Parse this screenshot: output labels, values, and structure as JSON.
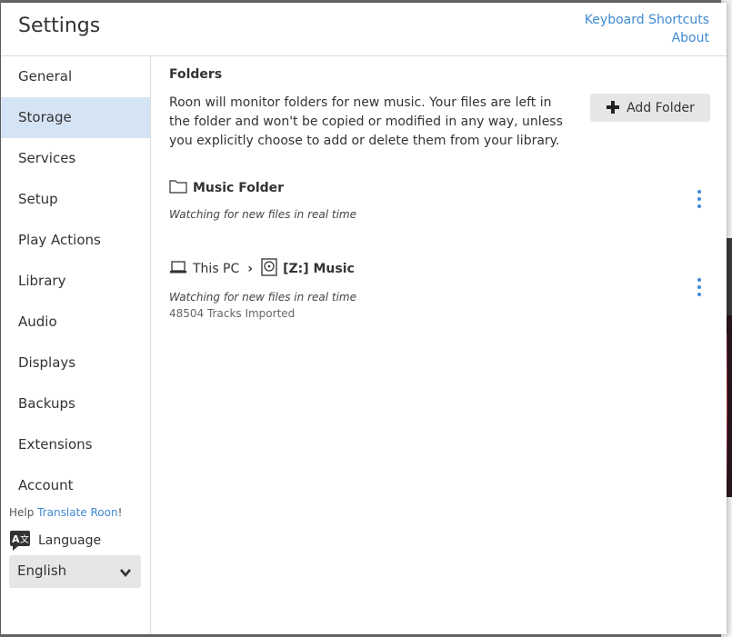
{
  "dialog": {
    "title": "Settings",
    "links": {
      "keyboard_shortcuts": "Keyboard Shortcuts",
      "about": "About"
    }
  },
  "sidebar": {
    "items": [
      {
        "label": "General"
      },
      {
        "label": "Storage",
        "active": true
      },
      {
        "label": "Services"
      },
      {
        "label": "Setup"
      },
      {
        "label": "Play Actions"
      },
      {
        "label": "Library"
      },
      {
        "label": "Audio"
      },
      {
        "label": "Displays"
      },
      {
        "label": "Backups"
      },
      {
        "label": "Extensions"
      },
      {
        "label": "Account"
      }
    ],
    "help_prefix": "Help ",
    "help_link": "Translate Roon",
    "help_suffix": "!",
    "language_label": "Language",
    "language_value": "English"
  },
  "storage": {
    "section_title": "Folders",
    "description": "Roon will monitor folders for new music. Your files are left in the folder and won't be copied or modified in any way, unless you explicitly choose to add or delete them from your library.",
    "add_button": "Add Folder",
    "folders": [
      {
        "icon": "folder-icon",
        "name": "Music Folder",
        "status": "Watching for new files in real time"
      },
      {
        "device_icon": "laptop-icon",
        "device": "This PC",
        "separator": "›",
        "drive_icon": "disk-icon",
        "name": "[Z:] Music",
        "status": "Watching for new files in real time",
        "tracks": "48504 Tracks Imported"
      }
    ]
  },
  "colors": {
    "accent": "#3f8bd3",
    "active_nav": "#d5e4f4",
    "button_bg": "#e6e6e6"
  }
}
